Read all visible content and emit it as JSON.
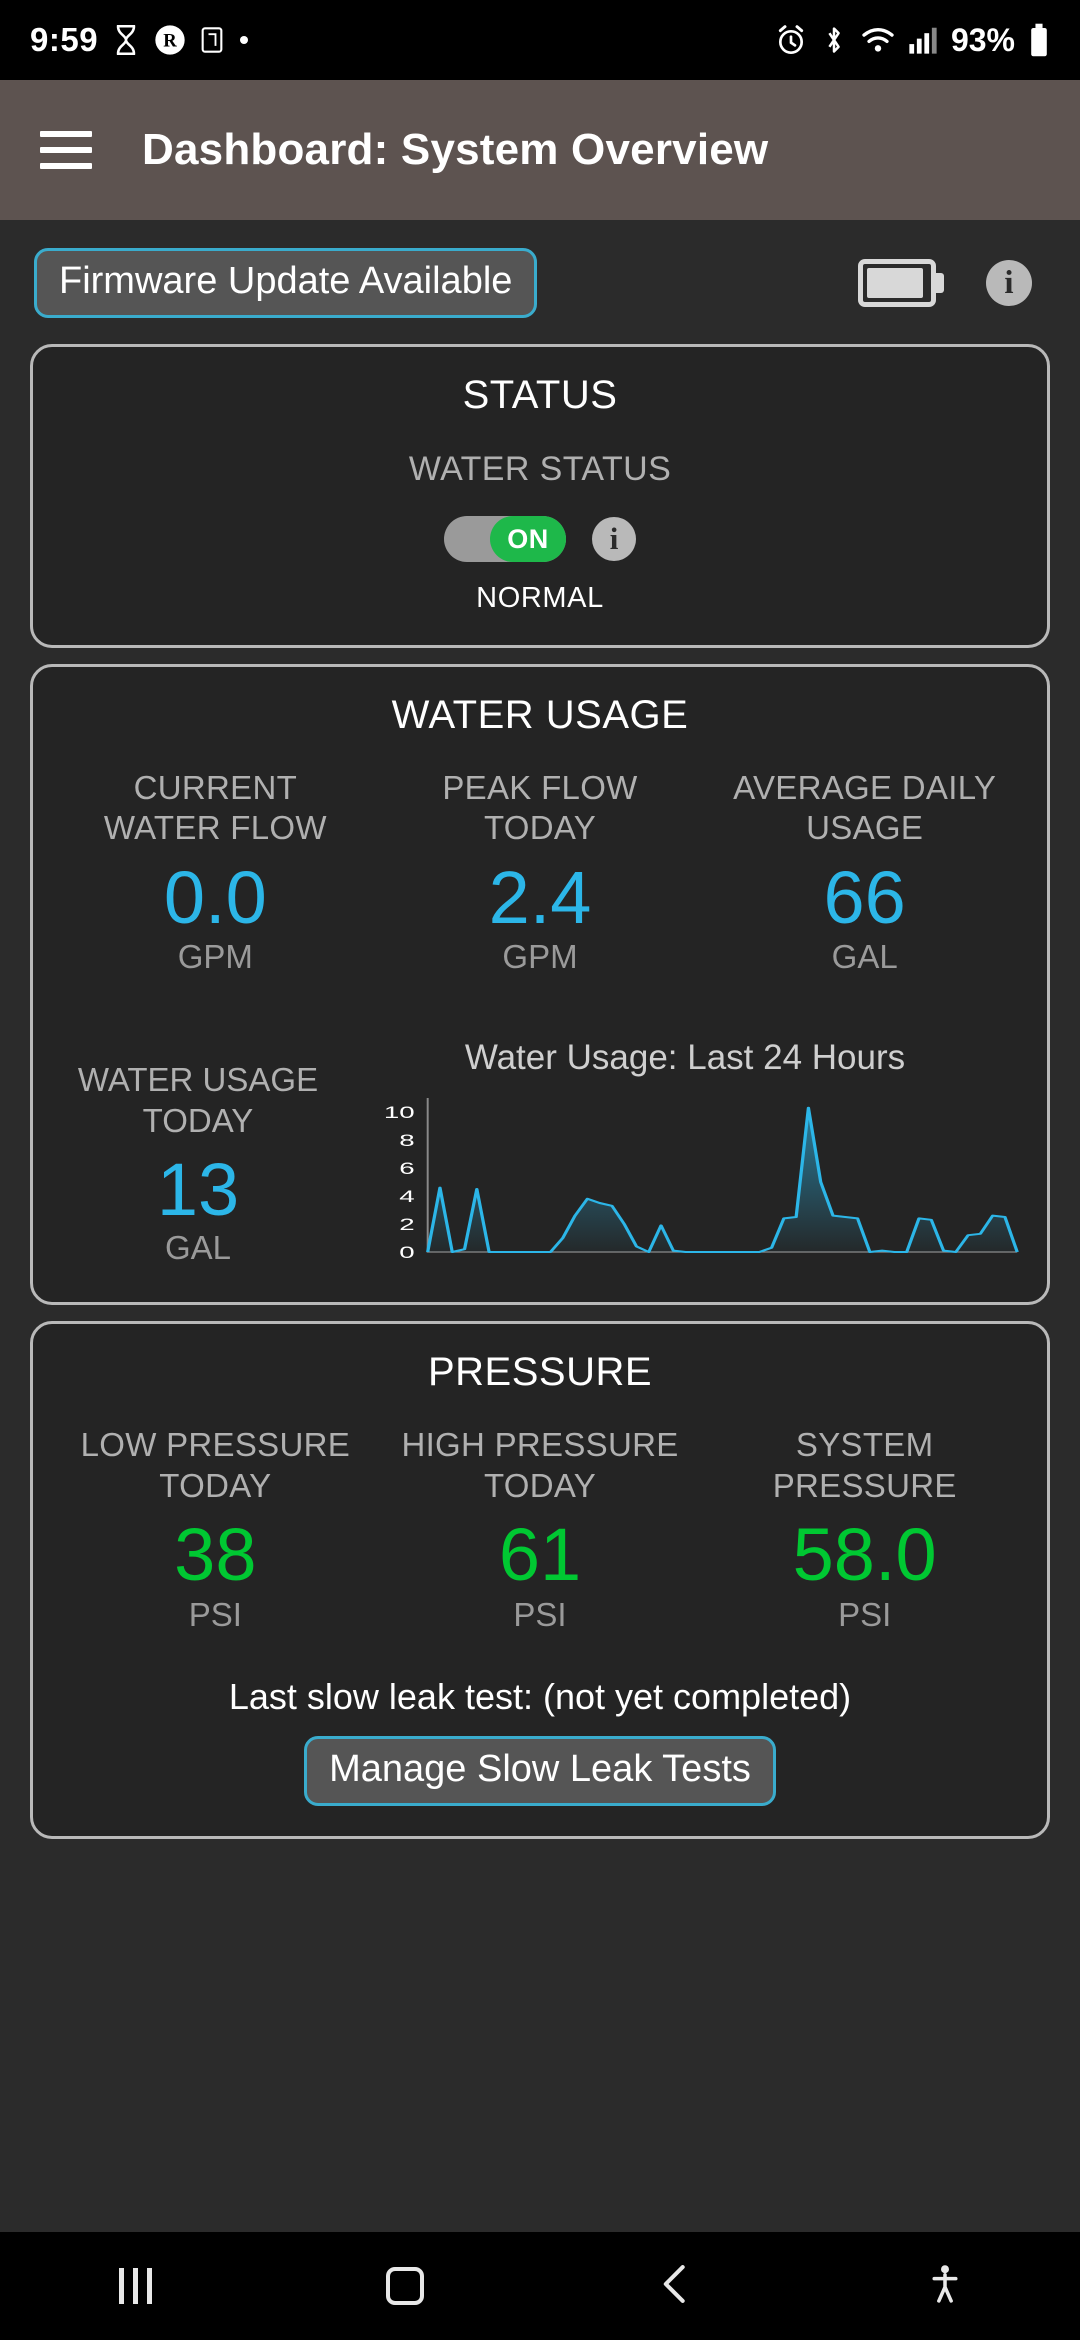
{
  "status_bar": {
    "time": "9:59",
    "battery_percent": "93%",
    "left_icons": [
      "hourglass-icon",
      "r-circle-icon",
      "nfc-tag-icon",
      "dot-icon"
    ],
    "right_icons": [
      "alarm-icon",
      "bluetooth-icon",
      "wifi-icon",
      "cellular-signal-icon",
      "battery-icon"
    ]
  },
  "app_bar": {
    "menu_icon": "hamburger-icon",
    "title": "Dashboard: System Overview"
  },
  "top_row": {
    "firmware_button": "Firmware Update Available",
    "battery_icon": "battery-icon",
    "info_icon": "info-icon"
  },
  "status_card": {
    "title": "STATUS",
    "water_status_label": "WATER STATUS",
    "toggle_value": "ON",
    "toggle_state": "on",
    "state_text": "NORMAL",
    "info_icon": "info-icon"
  },
  "water_usage_card": {
    "title": "WATER USAGE",
    "metrics": [
      {
        "label": "CURRENT\nWATER FLOW",
        "label_line1": "CURRENT",
        "label_line2": "WATER FLOW",
        "value": "0.0",
        "unit": "GPM"
      },
      {
        "label": "PEAK FLOW\nTODAY",
        "label_line1": "PEAK FLOW",
        "label_line2": "TODAY",
        "value": "2.4",
        "unit": "GPM"
      },
      {
        "label": "AVERAGE DAILY\nUSAGE",
        "label_line1": "AVERAGE DAILY",
        "label_line2": "USAGE",
        "value": "66",
        "unit": "GAL"
      }
    ],
    "today": {
      "label_line1": "WATER USAGE",
      "label_line2": "TODAY",
      "value": "13",
      "unit": "GAL"
    },
    "chart_title": "Water Usage: Last 24 Hours"
  },
  "pressure_card": {
    "title": "PRESSURE",
    "metrics": [
      {
        "label_line1": "LOW PRESSURE",
        "label_line2": "TODAY",
        "value": "38",
        "unit": "PSI"
      },
      {
        "label_line1": "HIGH PRESSURE",
        "label_line2": "TODAY",
        "value": "61",
        "unit": "PSI"
      },
      {
        "label_line1": "SYSTEM",
        "label_line2": "PRESSURE",
        "value": "58.0",
        "unit": "PSI"
      }
    ],
    "leak_test_text": "Last slow leak test:  (not yet completed)",
    "leak_test_button": "Manage Slow Leak Tests"
  },
  "nav_bar": {
    "recents_icon": "recents-icon",
    "home_icon": "home-icon",
    "back_icon": "back-icon",
    "accessibility_icon": "accessibility-icon"
  },
  "colors": {
    "accent_cyan": "#2cb6e8",
    "accent_green": "#00c832",
    "appbar_bg": "#5d5350",
    "page_bg": "#2b2b2b",
    "card_bg": "#242424",
    "card_border": "#b9b9b9"
  },
  "chart_data": {
    "type": "area",
    "title": "Water Usage: Last 24 Hours",
    "xlabel": "",
    "ylabel": "",
    "ylim": [
      0,
      11
    ],
    "yticks": [
      0,
      2,
      4,
      6,
      8,
      10
    ],
    "grid": false,
    "legend": "none",
    "line_color": "#2cb6e8",
    "fill": "gradient cyan to transparent",
    "x": [
      0,
      1,
      2,
      3,
      4,
      5,
      6,
      7,
      8,
      9,
      10,
      11,
      12,
      13,
      14,
      15,
      16,
      17,
      18,
      19,
      20,
      21,
      22,
      23,
      24,
      25,
      26,
      27,
      28,
      29,
      30,
      31,
      32,
      33,
      34,
      35,
      36,
      37,
      38,
      39,
      40,
      41,
      42,
      43,
      44,
      45,
      46,
      47
    ],
    "values": [
      0,
      4.6,
      0,
      0.2,
      4.5,
      0,
      0,
      0,
      0,
      0,
      0,
      1.0,
      2.6,
      3.8,
      3.5,
      3.3,
      2.0,
      0.4,
      0,
      1.9,
      0.1,
      0,
      0,
      0,
      0,
      0,
      0,
      0,
      0.3,
      2.4,
      2.5,
      10.3,
      5.0,
      2.6,
      2.5,
      2.4,
      0,
      0.1,
      0,
      0,
      2.4,
      2.3,
      0.1,
      0,
      1.2,
      1.3,
      2.6,
      2.5,
      0
    ]
  }
}
